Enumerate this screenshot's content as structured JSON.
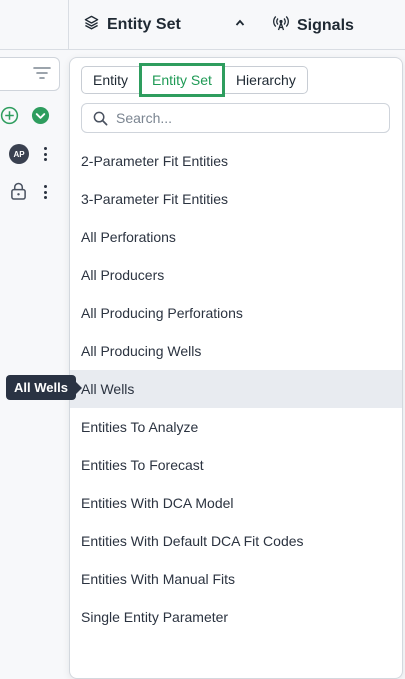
{
  "header": {
    "entity_set_title": "Entity Set",
    "signals_title": "Signals"
  },
  "left_panel": {
    "avatar_initials": "AP"
  },
  "popup": {
    "tabs": [
      {
        "label": "Entity",
        "active": false
      },
      {
        "label": "Entity Set",
        "active": true
      },
      {
        "label": "Hierarchy",
        "active": false
      }
    ],
    "search": {
      "placeholder": "Search...",
      "value": ""
    },
    "items": [
      {
        "label": "2-Parameter Fit Entities"
      },
      {
        "label": "3-Parameter Fit Entities"
      },
      {
        "label": "All Perforations"
      },
      {
        "label": "All Producers"
      },
      {
        "label": "All Producing Perforations"
      },
      {
        "label": "All Producing Wells"
      },
      {
        "label": "All Wells",
        "hovered": true
      },
      {
        "label": "Entities To Analyze"
      },
      {
        "label": "Entities To Forecast"
      },
      {
        "label": "Entities With DCA Model"
      },
      {
        "label": "Entities With Default DCA Fit Codes"
      },
      {
        "label": "Entities With Manual Fits"
      },
      {
        "label": "Single Entity Parameter"
      }
    ]
  },
  "tooltip": {
    "text": "All Wells"
  },
  "colors": {
    "accent_green": "#2e9d5e",
    "tooltip_bg": "#2a3343",
    "hover_bg": "#e8ebf0"
  },
  "icons": [
    "layers-icon",
    "chevron-up-icon",
    "signals-icon",
    "filter-icon",
    "add-circle-icon",
    "check-circle-icon",
    "lock-icon",
    "kebab-menu-icon",
    "search-icon"
  ]
}
